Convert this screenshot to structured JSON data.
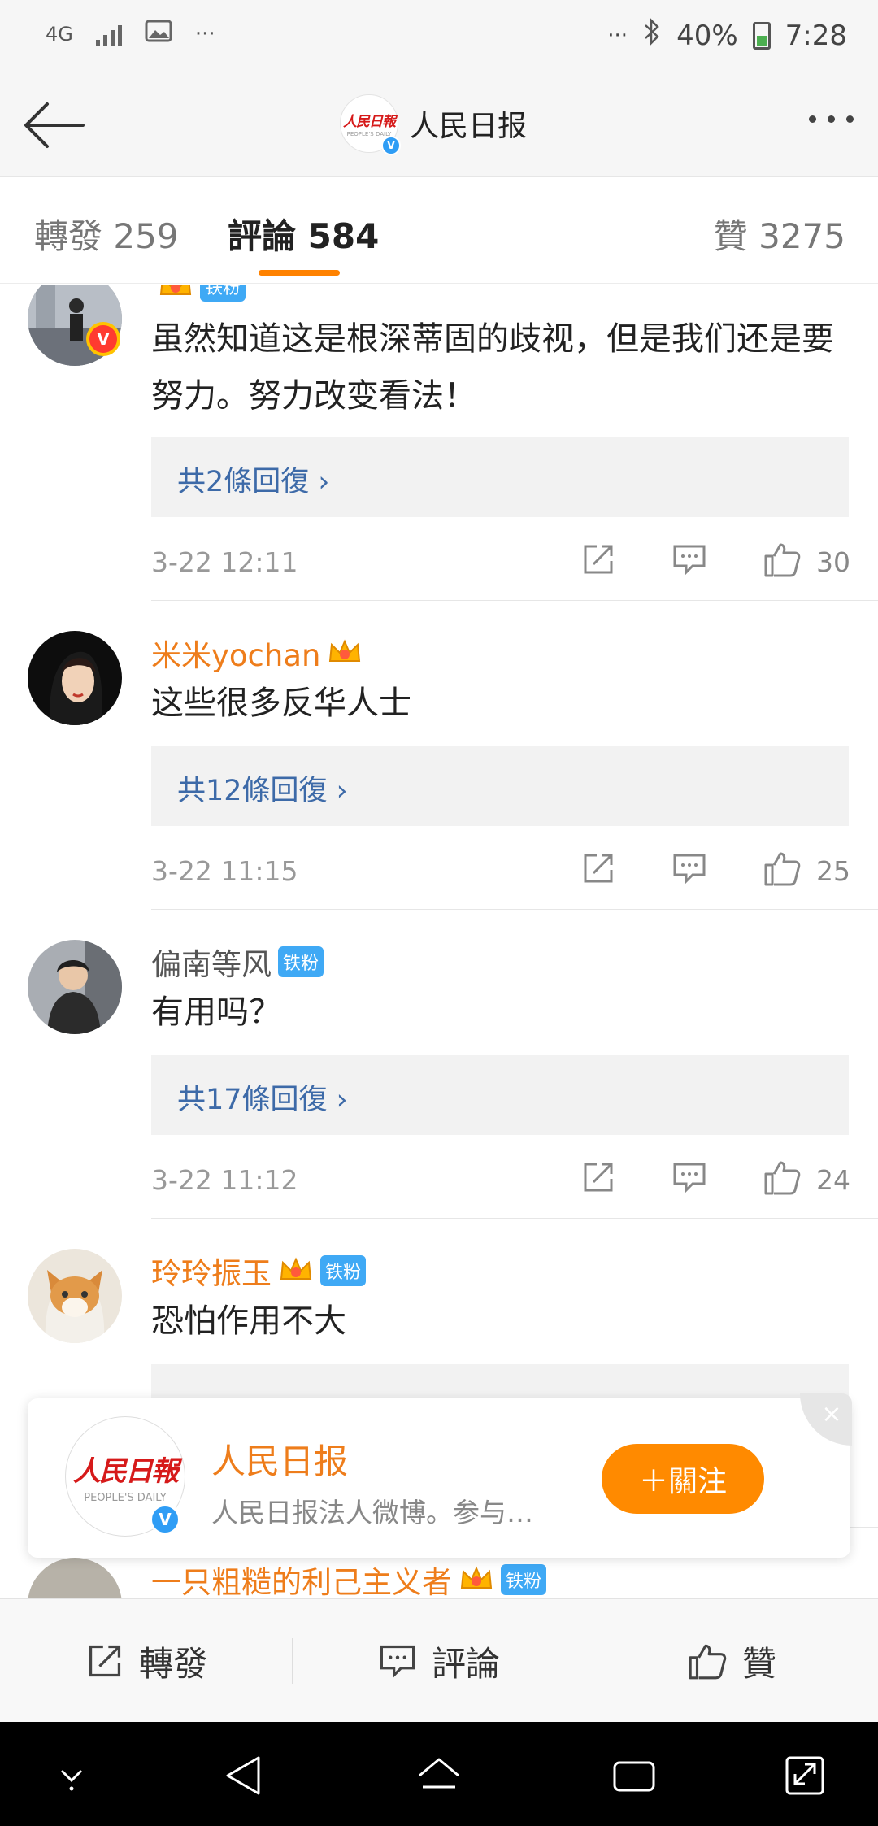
{
  "status_bar": {
    "network": "4G",
    "more_left": "···",
    "more_right": "···",
    "battery": "40%",
    "time": "7:28"
  },
  "header": {
    "title": "人民日报",
    "logo_cn": "人民日報",
    "logo_en": "PEOPLE'S DAILY",
    "verified": "V"
  },
  "tabs": [
    {
      "label": "轉發 259"
    },
    {
      "label": "評論 584"
    },
    {
      "label": "贊 3275"
    }
  ],
  "comments": [
    {
      "username": "",
      "crown": true,
      "fan_badge": "铁粉",
      "vip": true,
      "text": "虽然知道这是根深蒂固的歧视，但是我们还是要努力。努力改变看法！",
      "replies": "共2條回復 ›",
      "time": "3-22 12:11",
      "likes": "30"
    },
    {
      "username": "米米yochan",
      "crown": true,
      "fan_badge": "",
      "vip": false,
      "text": "这些很多反华人士",
      "replies": "共12條回復 ›",
      "time": "3-22 11:15",
      "likes": "25"
    },
    {
      "username": "偏南等风",
      "crown": false,
      "fan_badge": "铁粉",
      "vip": false,
      "text": "有用吗？",
      "replies": "共17條回復 ›",
      "time": "3-22 11:12",
      "likes": "24"
    },
    {
      "username": "玲玲振玉",
      "crown": true,
      "fan_badge": "铁粉",
      "vip": false,
      "text": "恐怕作用不大",
      "replies": "",
      "time": "",
      "likes": ""
    },
    {
      "username": "一只粗糙的利己主义者",
      "crown": true,
      "fan_badge": "铁粉",
      "vip": false,
      "text": "",
      "replies": "",
      "time": "",
      "likes": ""
    }
  ],
  "follow_card": {
    "name": "人民日报",
    "desc": "人民日报法人微博。参与…",
    "button": "＋關注",
    "close": "×"
  },
  "action_bar": {
    "repost": "轉發",
    "comment": "評論",
    "like": "贊"
  },
  "colors": {
    "accent": "#ff8200",
    "username": "#ee7d1b",
    "link": "#3d6aa8",
    "fan_badge": "#3fa9f5"
  }
}
